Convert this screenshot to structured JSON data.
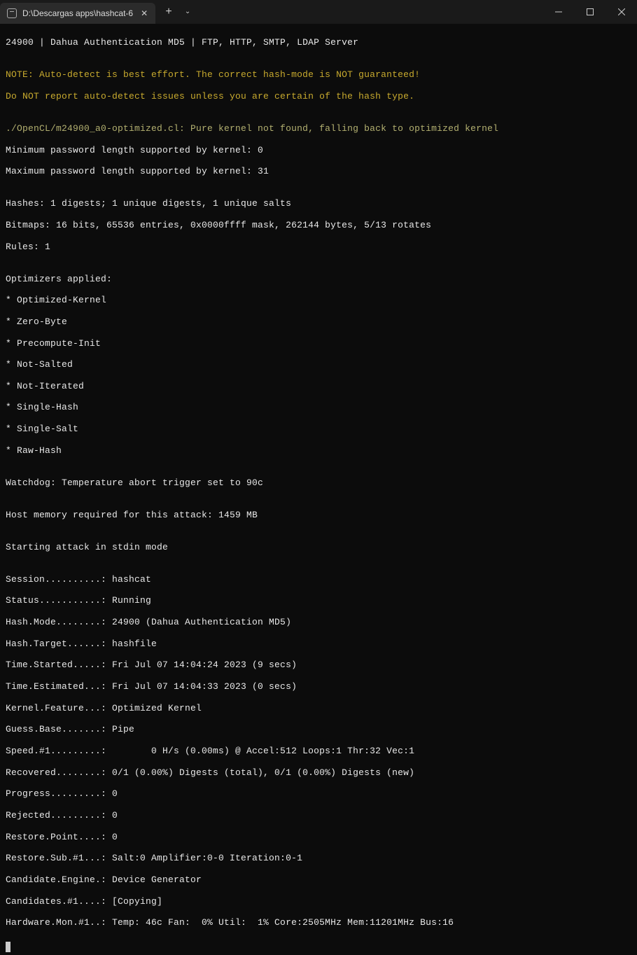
{
  "tab": {
    "title": "D:\\Descargas apps\\hashcat-6"
  },
  "lines": {
    "l0": "24900 | Dahua Authentication MD5 | FTP, HTTP, SMTP, LDAP Server",
    "l1": "",
    "l2": "NOTE: Auto-detect is best effort. The correct hash-mode is NOT guaranteed!",
    "l3": "Do NOT report auto-detect issues unless you are certain of the hash type.",
    "l4": "",
    "l5": "./OpenCL/m24900_a0-optimized.cl: Pure kernel not found, falling back to optimized kernel",
    "l6": "Minimum password length supported by kernel: 0",
    "l7": "Maximum password length supported by kernel: 31",
    "l8": "",
    "l9": "Hashes: 1 digests; 1 unique digests, 1 unique salts",
    "l10": "Bitmaps: 16 bits, 65536 entries, 0x0000ffff mask, 262144 bytes, 5/13 rotates",
    "l11": "Rules: 1",
    "l12": "",
    "l13": "Optimizers applied:",
    "l14": "* Optimized-Kernel",
    "l15": "* Zero-Byte",
    "l16": "* Precompute-Init",
    "l17": "* Not-Salted",
    "l18": "* Not-Iterated",
    "l19": "* Single-Hash",
    "l20": "* Single-Salt",
    "l21": "* Raw-Hash",
    "l22": "",
    "l23": "Watchdog: Temperature abort trigger set to 90c",
    "l24": "",
    "l25": "Host memory required for this attack: 1459 MB",
    "l26": "",
    "l27": "Starting attack in stdin mode",
    "l28": "",
    "l29": "Session..........: hashcat",
    "l30": "Status...........: Running",
    "l31": "Hash.Mode........: 24900 (Dahua Authentication MD5)",
    "l32": "Hash.Target......: hashfile",
    "l33": "Time.Started.....: Fri Jul 07 14:04:24 2023 (9 secs)",
    "l34": "Time.Estimated...: Fri Jul 07 14:04:33 2023 (0 secs)",
    "l35": "Kernel.Feature...: Optimized Kernel",
    "l36": "Guess.Base.......: Pipe",
    "l37": "Speed.#1.........:        0 H/s (0.00ms) @ Accel:512 Loops:1 Thr:32 Vec:1",
    "l38": "Recovered........: 0/1 (0.00%) Digests (total), 0/1 (0.00%) Digests (new)",
    "l39": "Progress.........: 0",
    "l40": "Rejected.........: 0",
    "l41": "Restore.Point....: 0",
    "l42": "Restore.Sub.#1...: Salt:0 Amplifier:0-0 Iteration:0-1",
    "l43": "Candidate.Engine.: Device Generator",
    "l44": "Candidates.#1....: [Copying]",
    "l45": "Hardware.Mon.#1..: Temp: 46c Fan:  0% Util:  1% Core:2505MHz Mem:11201MHz Bus:16"
  }
}
